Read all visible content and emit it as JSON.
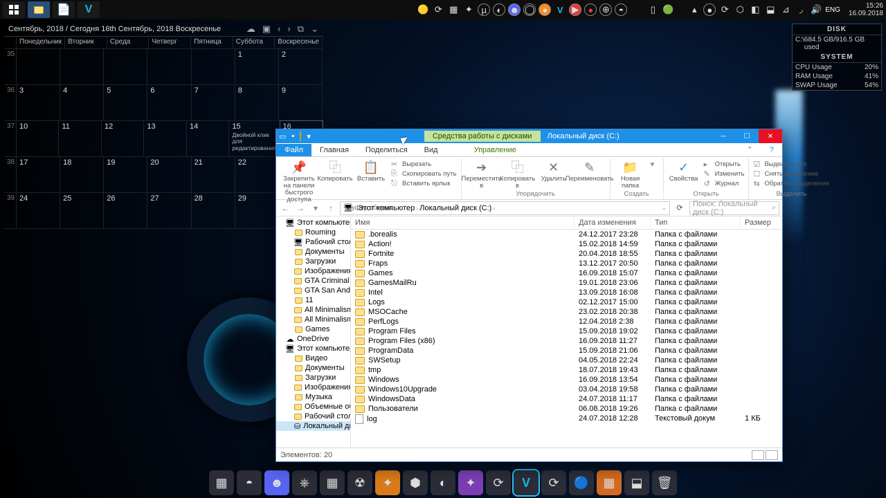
{
  "clock": {
    "time": "15:26",
    "date": "16.09.2018"
  },
  "tray_lang": "ENG",
  "calendar": {
    "title": "Сентябрь, 2018 / Сегодня 16th Сентябрь, 2018 Воскресенье",
    "weekdays": [
      "Понедельник",
      "Вторник",
      "Среда",
      "Четверг",
      "Пятница",
      "Суббота",
      "Воскресенье"
    ],
    "week_numbers": [
      " ",
      "35",
      "36",
      "37",
      "38",
      "39"
    ],
    "tip_line1": "Двойной клик",
    "tip_line2": "для",
    "tip_line3": "редактирования",
    "grid": [
      [
        "",
        "",
        "",
        "",
        "",
        "1",
        "2"
      ],
      [
        "3",
        "4",
        "5",
        "6",
        "7",
        "8",
        "9"
      ],
      [
        "10",
        "11",
        "12",
        "13",
        "14",
        "15",
        "16"
      ],
      [
        "17",
        "18",
        "19",
        "20",
        "21",
        "22",
        "23"
      ],
      [
        "24",
        "25",
        "26",
        "27",
        "28",
        "29",
        ""
      ]
    ]
  },
  "sysmon": {
    "disk_title": "DISK",
    "disk_drive": "C:\\",
    "disk_usage": "684.5 GB/916.5 GB used",
    "system_title": "SYSTEM",
    "cpu_label": "CPU Usage",
    "cpu_val": "20%",
    "ram_label": "RAM Usage",
    "ram_val": "41%",
    "swap_label": "SWAP Usage",
    "swap_val": "54%"
  },
  "explorer": {
    "drive_tools": "Средства работы с дисками",
    "title": "Локальный диск (C:)",
    "tabs": {
      "file": "Файл",
      "home": "Главная",
      "share": "Поделиться",
      "view": "Вид",
      "manage": "Управление"
    },
    "ribbon": {
      "pin": "Закрепить на панели быстрого доступа",
      "copy": "Копировать",
      "paste": "Вставить",
      "cut": "Вырезать",
      "copypath": "Скопировать путь",
      "shortcut": "Вставить ярлык",
      "group_clipboard": "Буфер обмена",
      "moveto": "Переместить в",
      "copyto": "Копировать в",
      "delete": "Удалить",
      "rename": "Переименовать",
      "group_organize": "Упорядочить",
      "newfolder": "Новая папка",
      "group_new": "Создать",
      "properties": "Свойства",
      "open": "Открыть",
      "edit": "Изменить",
      "history": "Журнал",
      "group_open": "Открыть",
      "selectall": "Выделить все",
      "selectnone": "Снять выделение",
      "invert": "Обратить выделение",
      "group_select": "Выделить"
    },
    "crumb": {
      "thispc": "Этот компьютер",
      "drive": "Локальный диск (C:)"
    },
    "search_placeholder": "Поиск: Локальный диск (C:)",
    "nav": [
      {
        "l": "Этот компьютер",
        "icon": "pc",
        "lv": 1
      },
      {
        "l": "Rouming",
        "icon": "f",
        "lv": 2
      },
      {
        "l": "Рабочий стол",
        "icon": "desk",
        "lv": 2
      },
      {
        "l": "Документы",
        "icon": "f",
        "lv": 2
      },
      {
        "l": "Загрузки",
        "icon": "f",
        "lv": 2
      },
      {
        "l": "Изображения",
        "icon": "f",
        "lv": 2
      },
      {
        "l": "GTA Criminal Ru",
        "icon": "f",
        "lv": 2
      },
      {
        "l": "GTA San Andreas",
        "icon": "f",
        "lv": 2
      },
      {
        "l": "11",
        "icon": "f",
        "lv": 2
      },
      {
        "l": "All Minimalism",
        "icon": "f",
        "lv": 2
      },
      {
        "l": "All Minimalism",
        "icon": "f",
        "lv": 2
      },
      {
        "l": "Games",
        "icon": "f",
        "lv": 2
      },
      {
        "l": "OneDrive",
        "icon": "od",
        "lv": 1
      },
      {
        "l": "Этот компьютер",
        "icon": "pc",
        "lv": 1
      },
      {
        "l": "Видео",
        "icon": "f",
        "lv": 2
      },
      {
        "l": "Документы",
        "icon": "f",
        "lv": 2
      },
      {
        "l": "Загрузки",
        "icon": "f",
        "lv": 2
      },
      {
        "l": "Изображения",
        "icon": "f",
        "lv": 2
      },
      {
        "l": "Музыка",
        "icon": "f",
        "lv": 2
      },
      {
        "l": "Объемные объекты",
        "icon": "f",
        "lv": 2
      },
      {
        "l": "Рабочий стол",
        "icon": "f",
        "lv": 2
      },
      {
        "l": "Локальный диск (C:)",
        "icon": "drv",
        "lv": 2,
        "sel": true
      }
    ],
    "columns": {
      "name": "Имя",
      "date": "Дата изменения",
      "type": "Тип",
      "size": "Размер"
    },
    "type_folder": "Папка с файлами",
    "type_text": "Текстовый докум",
    "rows": [
      {
        "n": ".borealis",
        "d": "24.12.2017 23:28",
        "t": "f"
      },
      {
        "n": "Action!",
        "d": "15.02.2018 14:59",
        "t": "f"
      },
      {
        "n": "Fortnite",
        "d": "20.04.2018 18:55",
        "t": "f"
      },
      {
        "n": "Fraps",
        "d": "13.12.2017 20:50",
        "t": "f"
      },
      {
        "n": "Games",
        "d": "16.09.2018 15:07",
        "t": "f"
      },
      {
        "n": "GamesMailRu",
        "d": "19.01.2018 23:06",
        "t": "f"
      },
      {
        "n": "Intel",
        "d": "13.09.2018 16:08",
        "t": "f"
      },
      {
        "n": "Logs",
        "d": "02.12.2017 15:00",
        "t": "f"
      },
      {
        "n": "MSOCache",
        "d": "23.02.2018 20:38",
        "t": "f"
      },
      {
        "n": "PerfLogs",
        "d": "12.04.2018 2:38",
        "t": "f"
      },
      {
        "n": "Program Files",
        "d": "15.09.2018 19:02",
        "t": "f"
      },
      {
        "n": "Program Files (x86)",
        "d": "16.09.2018 11:27",
        "t": "f"
      },
      {
        "n": "ProgramData",
        "d": "15.09.2018 21:06",
        "t": "f"
      },
      {
        "n": "SWSetup",
        "d": "04.05.2018 22:24",
        "t": "f"
      },
      {
        "n": "tmp",
        "d": "18.07.2018 19:43",
        "t": "f"
      },
      {
        "n": "Windows",
        "d": "16.09.2018 13:54",
        "t": "f"
      },
      {
        "n": "Windows10Upgrade",
        "d": "03.04.2018 19:58",
        "t": "f"
      },
      {
        "n": "WindowsData",
        "d": "24.07.2018 11:17",
        "t": "f"
      },
      {
        "n": "Пользователи",
        "d": "06.08.2018 19:26",
        "t": "f"
      },
      {
        "n": "log",
        "d": "24.07.2018 12:28",
        "t": "t",
        "s": "1 КБ"
      }
    ],
    "status": "Элементов: 20"
  }
}
